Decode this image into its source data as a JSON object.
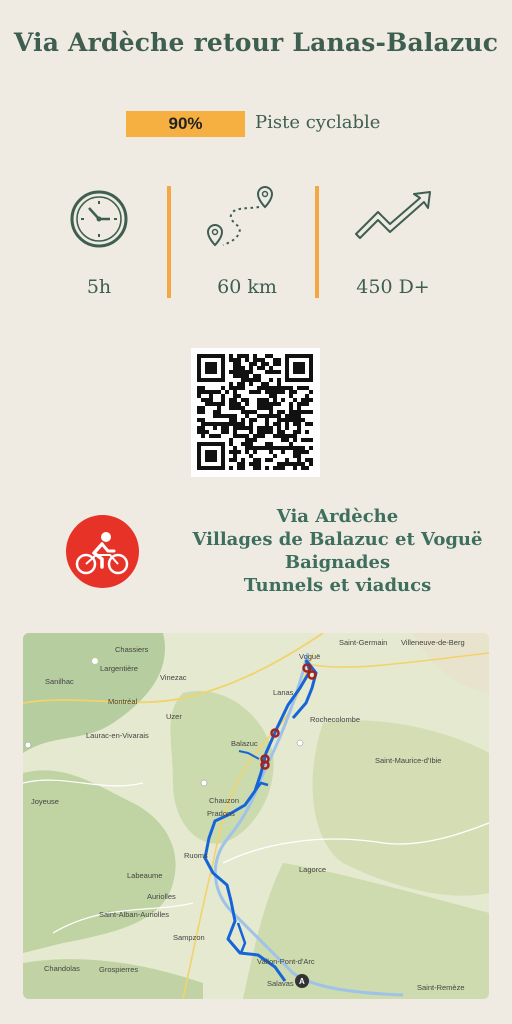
{
  "title": "Via Ardèche retour Lanas-Balazuc",
  "surface": {
    "percent": "90%",
    "label": "Piste cyclable"
  },
  "stats": {
    "duration": {
      "icon": "clock-icon",
      "value": "5h"
    },
    "distance": {
      "icon": "route-pins-icon",
      "value": "60 km"
    },
    "elevation": {
      "icon": "trend-up-arrow-icon",
      "value": "450 D+"
    }
  },
  "qr": {
    "icon": "qr-code"
  },
  "activity": {
    "icon": "cyclist-icon",
    "color": "#e63227"
  },
  "highlights": [
    "Via Ardèche",
    "Villages de Balazuc et Voguë",
    "Baignades",
    "Tunnels et viaducs"
  ],
  "map": {
    "route_color": "#1565d8",
    "start_marker": "A",
    "places": {
      "chassiers": "Chassiers",
      "largentiere": "Largentière",
      "sanilhac": "Sanilhac",
      "vinezac": "Vinezac",
      "montreal": "Montréal",
      "uzer": "Uzer",
      "laurac": "Laurac-en-Vivarais",
      "vogue": "Voguë",
      "saint_germain": "Saint-Germain",
      "villeneuve": "Villeneuve-de-Berg",
      "lanas": "Lanas",
      "rochecolombe": "Rochecolombe",
      "balazuc": "Balazuc",
      "saint_maurice": "Saint-Maurice-d'Ibie",
      "chauzon": "Chauzon",
      "joyeuse": "Joyeuse",
      "pradons": "Pradons",
      "ruoms": "Ruoms",
      "lagorce": "Lagorce",
      "labeaume": "Labeaume",
      "auriolles": "Auriolles",
      "saint_alban": "Saint-Alban-Auriolles",
      "sampzon": "Sampzon",
      "vallon": "Vallon-Pont-d'Arc",
      "chandolas": "Chandolas",
      "grospierres": "Grospierres",
      "salavas": "Salavas",
      "saint_remeze": "Saint-Remèze"
    }
  }
}
